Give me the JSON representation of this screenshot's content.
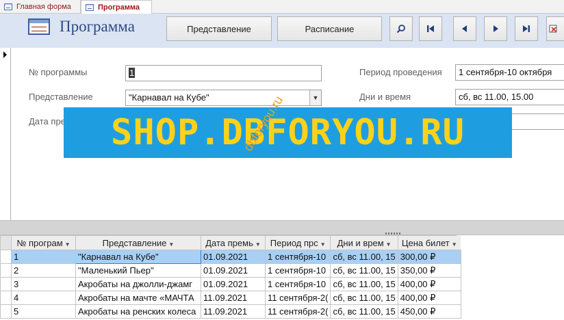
{
  "tabs": [
    {
      "label": "Главная форма"
    },
    {
      "label": "Программа"
    }
  ],
  "header": {
    "title": "Программа",
    "buttons": {
      "presentation": "Представление",
      "schedule": "Расписание"
    },
    "icons": [
      "search-icon",
      "first-record-icon",
      "previous-record-icon",
      "next-record-icon",
      "last-record-icon",
      "close-icon"
    ]
  },
  "form": {
    "program_no_label": "№ программы",
    "program_no_value": "1",
    "presentation_label": "Представление",
    "presentation_value": "\"Карнавал на Кубе\"",
    "premiere_label": "Дата пре",
    "period_label": "Период проведения",
    "period_value": "1 сентября-10 октября",
    "days_label": "Дни и время",
    "days_value": "сб, вс 11.00, 15.00"
  },
  "watermark": {
    "banner": "SHOP.DBFORYOU.RU",
    "diagonal": "dbforyou.ru"
  },
  "datasheet": {
    "columns": [
      "№ програм",
      "Представление",
      "Дата премь",
      "Период прс",
      "Дни и врем",
      "Цена билет"
    ],
    "rows": [
      [
        "1",
        "\"Карнавал на Кубе\"",
        "01.09.2021",
        "1 сентября-10",
        "сб, вс 11.00, 15",
        "300,00 ₽"
      ],
      [
        "2",
        "\"Маленький Пьер\"",
        "01.09.2021",
        "1 сентября-10",
        "сб, вс 11.00, 15",
        "350,00 ₽"
      ],
      [
        "3",
        "Акробаты на джолли-джамг",
        "01.09.2021",
        "1 сентября-10",
        "сб, вс 11.00, 15",
        "400,00 ₽"
      ],
      [
        "4",
        "Акробаты на мачте «МАЧТА",
        "11.09.2021",
        "11 сентября-2(",
        "сб, вс 11.00, 15",
        "400,00 ₽"
      ],
      [
        "5",
        "Акробаты на ренских колеса",
        "11.09.2021",
        "11 сентября-2(",
        "сб, вс 11.00, 15",
        "450,00 ₽"
      ]
    ]
  },
  "colors": {
    "header_bg": "#dbe4f3",
    "title": "#2e4a82",
    "tab_active_text": "#a31515",
    "selected_row": "#a8d0f5",
    "watermark_bg": "#1e9ee0",
    "watermark_text": "#ffd21a"
  }
}
